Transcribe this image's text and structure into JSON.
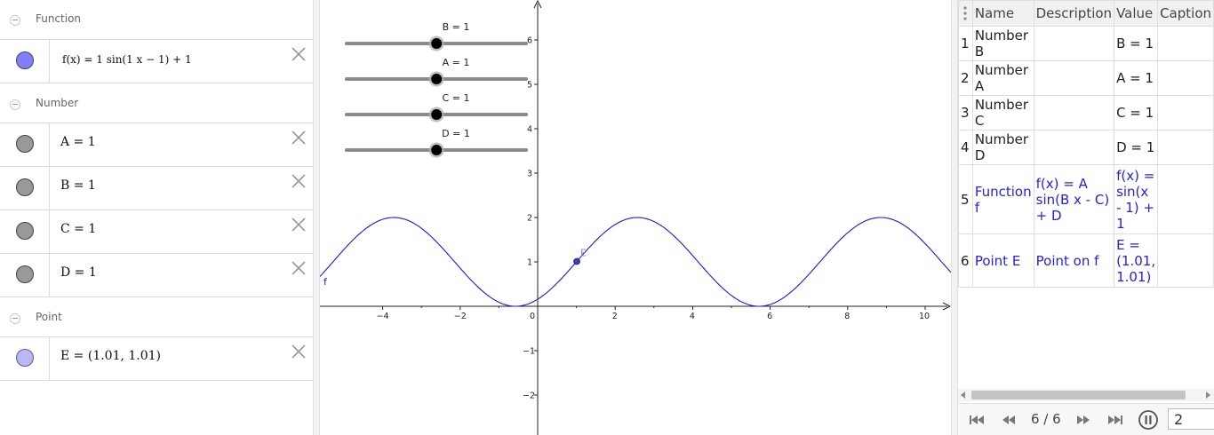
{
  "algebra": {
    "groups": {
      "function": "Function",
      "number": "Number",
      "point": "Point"
    },
    "items": {
      "f": "f(x) = 1 sin(1 x − 1) + 1",
      "A": "A = 1",
      "B": "B = 1",
      "C": "C = 1",
      "D": "D = 1",
      "E": "E = (1.01, 1.01)"
    },
    "colors": {
      "function_marble": "#8080ff",
      "number_marble": "#999999",
      "point_marble": "#b8b8f2"
    }
  },
  "graphics": {
    "sliders": [
      {
        "label": "B = 1",
        "value": 1
      },
      {
        "label": "A = 1",
        "value": 1
      },
      {
        "label": "C = 1",
        "value": 1
      },
      {
        "label": "D = 1",
        "value": 1
      }
    ],
    "function_label": "f",
    "point_label": "E",
    "point": {
      "x": 1.01,
      "y": 1.01
    },
    "x_ticks": [
      "−4",
      "−2",
      "0",
      "2",
      "4",
      "6",
      "8",
      "10"
    ],
    "y_ticks": [
      "6",
      "5",
      "4",
      "3",
      "2",
      "1",
      "−1",
      "−2"
    ],
    "curve_color": "#1a1ad6",
    "point_color": "#4040b0"
  },
  "protocol": {
    "headers": [
      "Name",
      "Description",
      "Value",
      "Caption"
    ],
    "rows": [
      {
        "num": "1",
        "name": "Number B",
        "description": "",
        "value": "B = 1",
        "caption": "",
        "blue": false
      },
      {
        "num": "2",
        "name": "Number A",
        "description": "",
        "value": "A = 1",
        "caption": "",
        "blue": false
      },
      {
        "num": "3",
        "name": "Number C",
        "description": "",
        "value": "C = 1",
        "caption": "",
        "blue": false
      },
      {
        "num": "4",
        "name": "Number D",
        "description": "",
        "value": "D = 1",
        "caption": "",
        "blue": false
      },
      {
        "num": "5",
        "name": "Function f",
        "description": "f(x) = A sin(B x - C) + D",
        "value": "f(x) = sin(x - 1) + 1",
        "caption": "",
        "blue": true
      },
      {
        "num": "6",
        "name": "Point E",
        "description": "Point on f",
        "value": "E = (1.01, 1.01)",
        "caption": "",
        "blue": true
      }
    ],
    "nav": {
      "counter": "6 / 6",
      "speed": "2"
    }
  }
}
